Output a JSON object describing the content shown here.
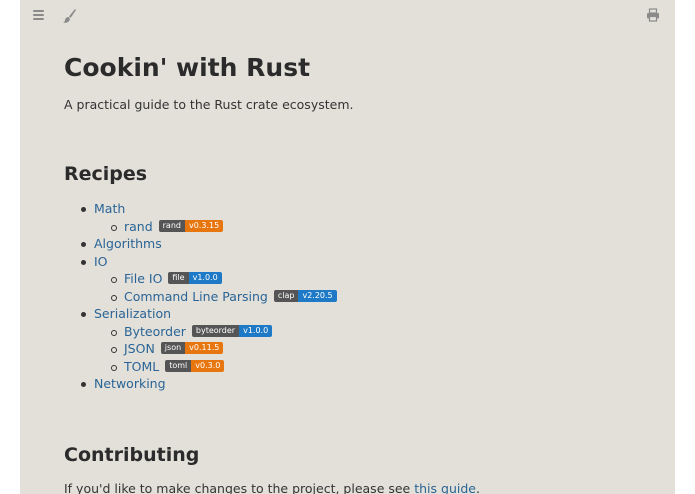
{
  "colors": {
    "page_background": "#e2e0d9",
    "link": "#2a6496",
    "badge_name": "#555555",
    "badge_orange": "#e8760e",
    "badge_blue": "#1e7ac6"
  },
  "toolbar": {
    "menu_icon": "hamburger-icon",
    "theme_icon": "paintbrush-icon",
    "print_icon": "printer-icon"
  },
  "header": {
    "title": "Cookin' with Rust",
    "description": "A practical guide to the Rust crate ecosystem."
  },
  "recipes": {
    "title": "Recipes",
    "items": [
      {
        "label": "Math"
      },
      {
        "label": "rand",
        "crate": "rand",
        "version": "v0.3.15",
        "version_color": "#e8760e"
      },
      {
        "label": "Algorithms"
      },
      {
        "label": "IO"
      },
      {
        "label": "File IO",
        "crate": "file",
        "version": "v1.0.0",
        "version_color": "#1e7ac6"
      },
      {
        "label": "Command Line Parsing",
        "crate": "clap",
        "version": "v2.20.5",
        "version_color": "#1e7ac6"
      },
      {
        "label": "Serialization"
      },
      {
        "label": "Byteorder",
        "crate": "byteorder",
        "version": "v1.0.0",
        "version_color": "#1e7ac6"
      },
      {
        "label": "JSON",
        "crate": "json",
        "version": "v0.11.5",
        "version_color": "#e8760e"
      },
      {
        "label": "TOML",
        "crate": "toml",
        "version": "v0.3.0",
        "version_color": "#e8760e"
      },
      {
        "label": "Networking"
      }
    ]
  },
  "contributing": {
    "title": "Contributing",
    "text_before": "If you'd like to make changes to the project, please see ",
    "link": "this guide",
    "text_after": "."
  }
}
